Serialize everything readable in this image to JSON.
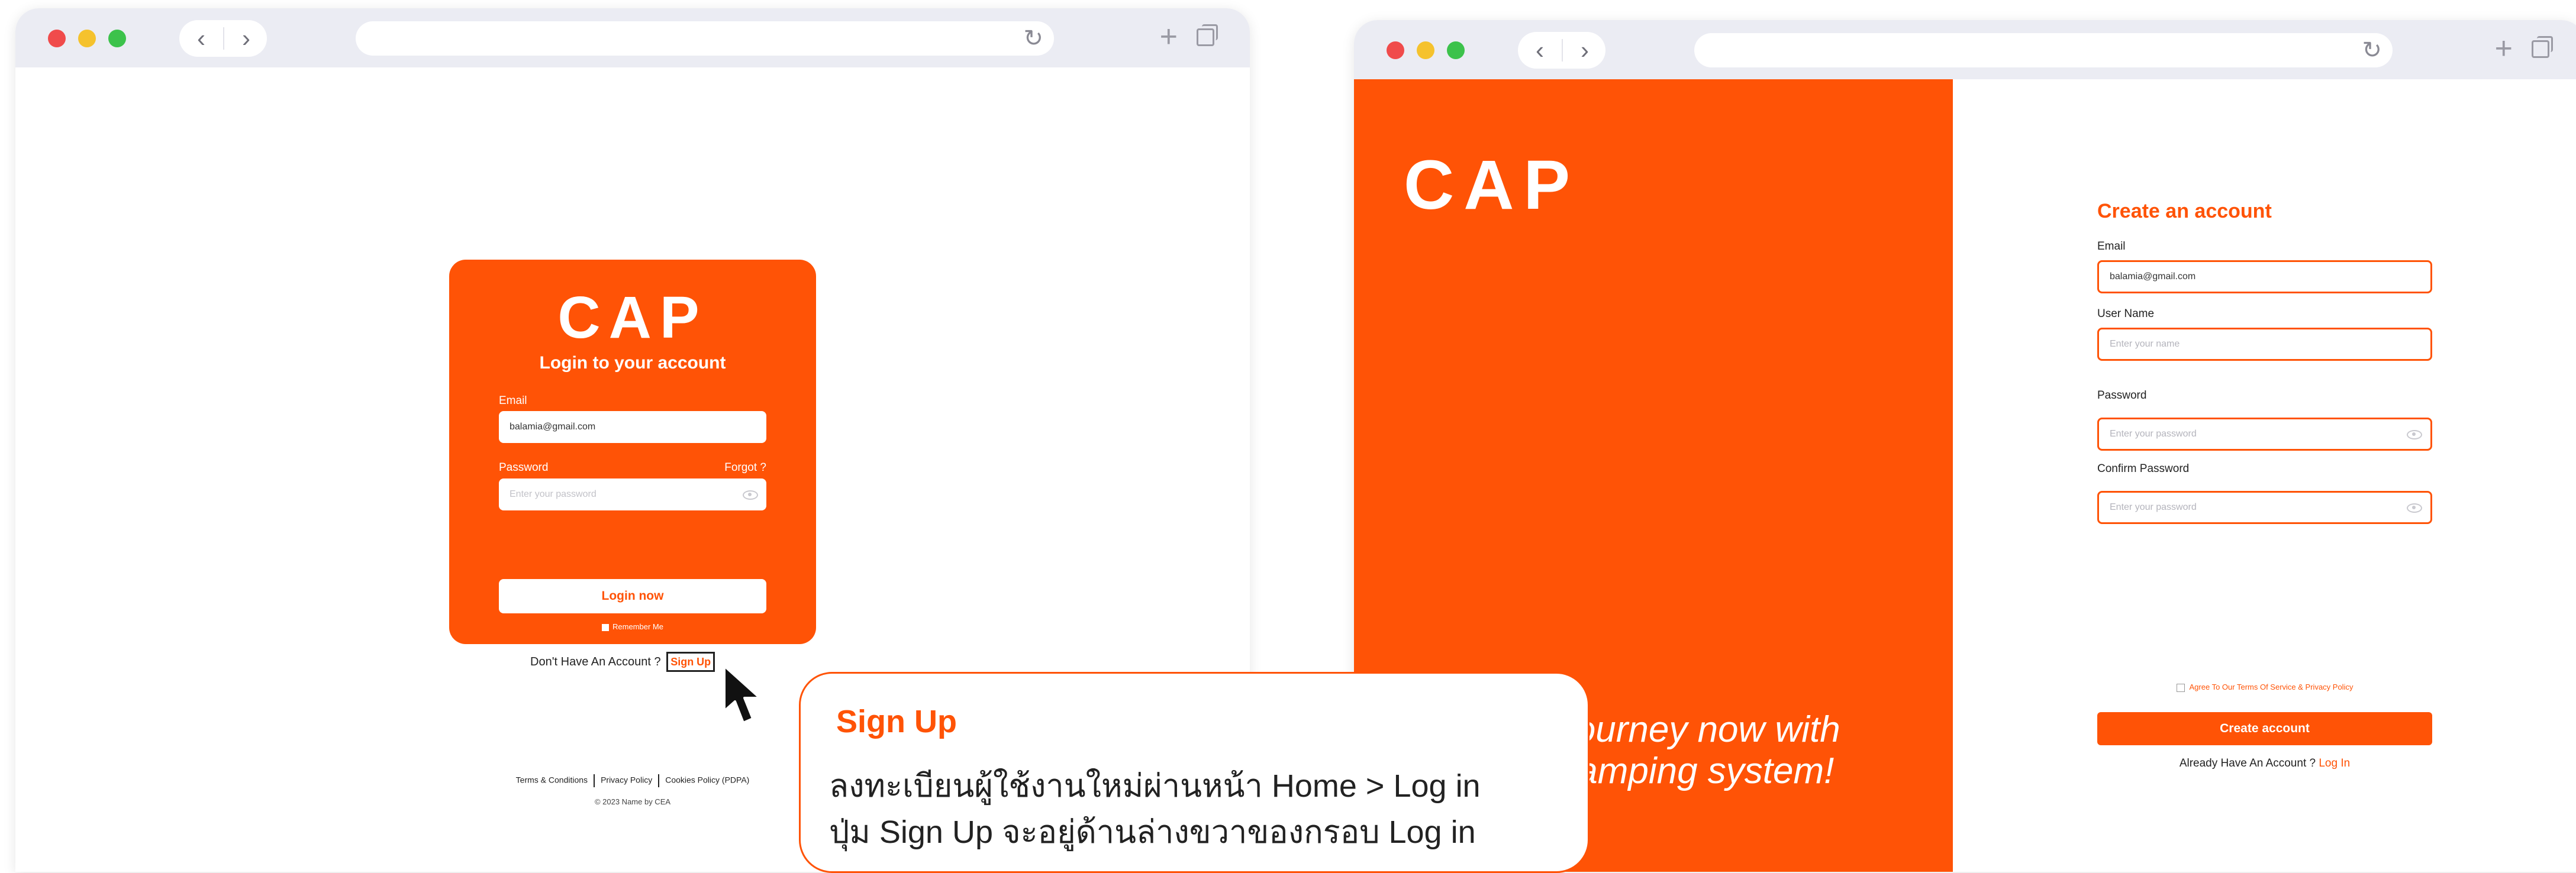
{
  "left_page": {
    "logo": "CAP",
    "title": "Login to your account",
    "email_label": "Email",
    "email_value": "balamia@gmail.com",
    "password_label": "Password",
    "forgot_label": "Forgot ?",
    "password_placeholder": "Enter your password",
    "login_button": "Login now",
    "remember_label": "Remember Me",
    "no_account_text": "Don't Have An Account ?",
    "signup_link": "Sign Up",
    "footer": {
      "terms": "Terms & Conditions",
      "privacy": "Privacy Policy",
      "cookies": "Cookies Policy (PDPA)",
      "copyright": "© 2023 Name by CEA"
    }
  },
  "right_page": {
    "logo": "CAP",
    "tagline_line1": "journey now with",
    "tagline_line2": "tamping system!",
    "form_title": "Create an account",
    "email_label": "Email",
    "email_value": "balamia@gmail.com",
    "username_label": "User Name",
    "username_placeholder": "Enter your name",
    "password_label": "Password",
    "password_placeholder": "Enter your password",
    "confirm_label": "Confirm Password",
    "confirm_placeholder": "Enter your password",
    "agree_text": "Agree To Our Terms Of Service & Privacy Policy",
    "create_button": "Create account",
    "already_text": "Already Have An Account ?",
    "login_link": "Log In"
  },
  "callout": {
    "title": "Sign Up",
    "line1": "ลงทะเบียนผู้ใช้งานใหม่ผ่านหน้า Home  >  Log in",
    "line2": "ปุ่ม Sign Up จะอยู่ด้านล่างขวาของกรอบ Log in"
  },
  "colors": {
    "brand": "#ff5306",
    "chrome": "#ebecf3"
  },
  "icons": [
    "back-arrow-icon",
    "forward-arrow-icon",
    "reload-icon",
    "new-tab-icon",
    "tabs-icon",
    "eye-icon",
    "cursor-arrow-icon"
  ]
}
